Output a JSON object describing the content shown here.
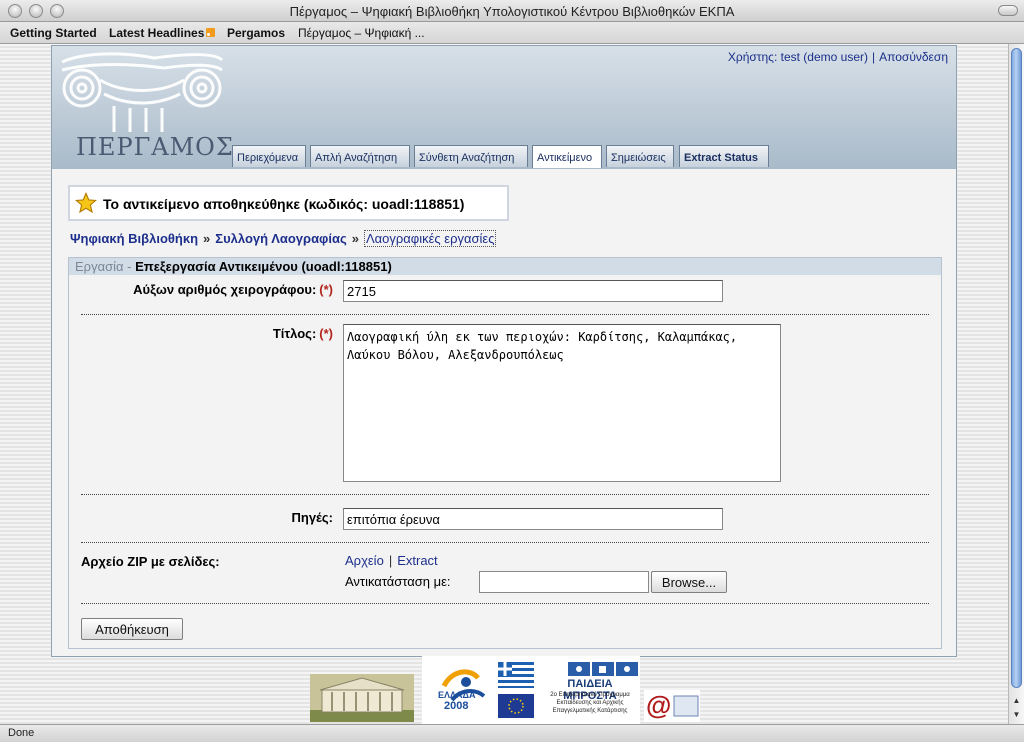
{
  "window": {
    "title": "Πέργαμος – Ψηφιακή Βιβλιοθήκη Υπολογιστικού Κέντρου Βιβλιοθηκών ΕΚΠΑ"
  },
  "bookmarks": {
    "items": [
      "Getting Started",
      "Latest Headlines",
      "Pergamos",
      "Πέργαμος – Ψηφιακή ..."
    ],
    "rss_icon": "rss-icon"
  },
  "site": {
    "logo_text": "ΠΕΡΓΑΜΟΣ",
    "user": {
      "label": "Χρήστης: test (demo user)",
      "separator": "|",
      "logout": "Αποσύνδεση"
    },
    "tabs": [
      "Περιεχόμενα",
      "Απλή Αναζήτηση",
      "Σύνθετη Αναζήτηση",
      "Αντικείμενο",
      "Σημειώσεις",
      "Extract Status"
    ],
    "active_tab": "Αντικείμενο"
  },
  "notice": {
    "icon": "star-icon",
    "text": "Το αντικείμενο αποθηκεύθηκε (κωδικός: uoadl:118851)"
  },
  "breadcrumb": {
    "items": [
      "Ψηφιακή Βιβλιοθήκη",
      "Συλλογή Λαογραφίας",
      "Λαογραφικές εργασίες"
    ],
    "separator": "»"
  },
  "form": {
    "header_category": "Εργασία",
    "header_dash": " - ",
    "header_title": "Επεξεργασία Αντικειμένου (uoadl:118851)",
    "required_marker": "(*)",
    "manuscript": {
      "label": "Αύξων αριθμός χειρογράφου:",
      "value": "2715"
    },
    "title": {
      "label": "Τίτλος:",
      "value": "Λαογραφική ύλη εκ των περιοχών: Καρδίτσης, Καλαμπάκας, Λαύκου Βόλου, Αλεξανδρουπόλεως"
    },
    "sources": {
      "label": "Πηγές:",
      "value": "επιτόπια έρευνα"
    },
    "zip": {
      "label": "Αρχείο ZIP με σελίδες:",
      "file_link": "Αρχείο",
      "pipe": "|",
      "extract_link": "Extract",
      "replace_label": "Αντικατάσταση με:",
      "browse_button": "Browse..."
    },
    "save_button": "Αποθήκευση"
  },
  "footer": {
    "logos": [
      "university-building-logo",
      "ellada-2008-logo",
      "greek-flag-logo",
      "eu-flag-logo",
      "paideia-mprosta-logo",
      "at-sign-logo"
    ],
    "ellada_text": "ΕΛΛΑΔΑ",
    "ellada_year": "2008",
    "paideia_title": "ΠΑΙΔΕΙΑ ΜΠΡΟΣΤΑ",
    "paideia_sub": [
      "2ο Επιχειρησιακό Πρόγραμμα",
      "Εκπαίδευσης και Αρχικής",
      "Επαγγελματικής Κατάρτισης"
    ]
  },
  "status": {
    "text": "Done"
  },
  "colors": {
    "link": "#1d2f8c",
    "required": "#b3261e",
    "header_band": "#d1dce6"
  }
}
